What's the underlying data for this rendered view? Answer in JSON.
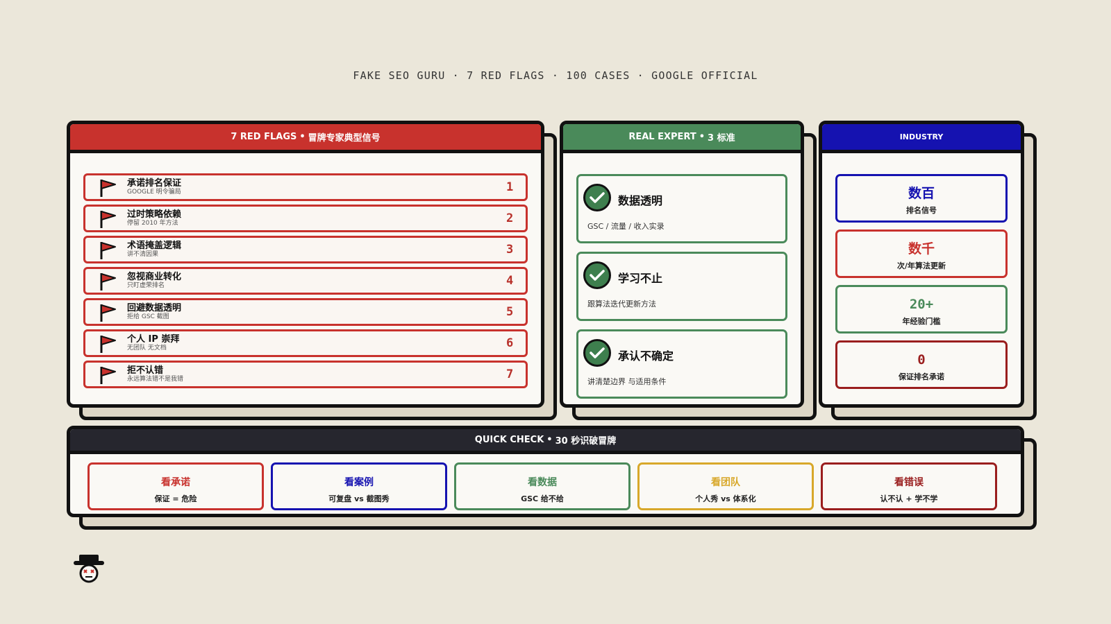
{
  "header": {
    "title": "FAKE SEO GURU · 7 RED FLAGS · 100 CASES · GOOGLE OFFICIAL"
  },
  "colors": {
    "red": "#c8322d",
    "green": "#4a8a5a",
    "blue": "#1512b0",
    "dark": "#26262e",
    "gold": "#d8a82a",
    "darkred": "#9a1e1e",
    "bg": "#ebe7da"
  },
  "red_flags": {
    "title_main": "7 RED FLAGS",
    "title_sep": "•",
    "title_sub": "冒牌专家典型信号",
    "items": [
      {
        "title": "承诺排名保证",
        "sub": "GOOGLE 明令骗局",
        "num": "1",
        "icon": "red-flag-icon"
      },
      {
        "title": "过时策略依赖",
        "sub": "停留 2010 年方法",
        "num": "2",
        "icon": "red-flag-icon"
      },
      {
        "title": "术语掩盖逻辑",
        "sub": "讲不清因果",
        "num": "3",
        "icon": "red-flag-icon"
      },
      {
        "title": "忽视商业转化",
        "sub": "只盯虚荣排名",
        "num": "4",
        "icon": "red-flag-icon"
      },
      {
        "title": "回避数据透明",
        "sub": "拒给 GSC 截图",
        "num": "5",
        "icon": "red-flag-icon"
      },
      {
        "title": "个人 IP 崇拜",
        "sub": "无团队 无文档",
        "num": "6",
        "icon": "red-flag-icon"
      },
      {
        "title": "拒不认错",
        "sub": "永远算法错不是我错",
        "num": "7",
        "icon": "red-flag-icon"
      }
    ]
  },
  "real_expert": {
    "title_main": "REAL EXPERT",
    "title_sep": "•",
    "title_sub": "3 标准",
    "items": [
      {
        "title": "数据透明",
        "sub": "GSC / 流量 / 收入实录",
        "icon": "check-icon"
      },
      {
        "title": "学习不止",
        "sub": "跟算法迭代更新方法",
        "icon": "check-icon"
      },
      {
        "title": "承认不确定",
        "sub": "讲清楚边界 与适用条件",
        "icon": "check-icon"
      }
    ]
  },
  "industry": {
    "title": "INDUSTRY",
    "items": [
      {
        "value": "数百",
        "label": "排名信号"
      },
      {
        "value": "数千",
        "label": "次/年算法更新"
      },
      {
        "value": "20+",
        "label": "年经验门槛"
      },
      {
        "value": "0",
        "label": "保证排名承诺"
      }
    ]
  },
  "quick_check": {
    "title_main": "QUICK CHECK",
    "title_sep": "•",
    "title_sub": "30 秒识破冒牌",
    "items": [
      {
        "value": "看承诺",
        "label": "保证 = 危险"
      },
      {
        "value": "看案例",
        "label": "可复盘 vs 截图秀"
      },
      {
        "value": "看数据",
        "label": "GSC 给不给"
      },
      {
        "value": "看团队",
        "label": "个人秀 vs 体系化"
      },
      {
        "value": "看错误",
        "label": "认不认 + 学不学"
      }
    ]
  },
  "mascot": {
    "icon": "fake-guru-mascot-icon"
  }
}
